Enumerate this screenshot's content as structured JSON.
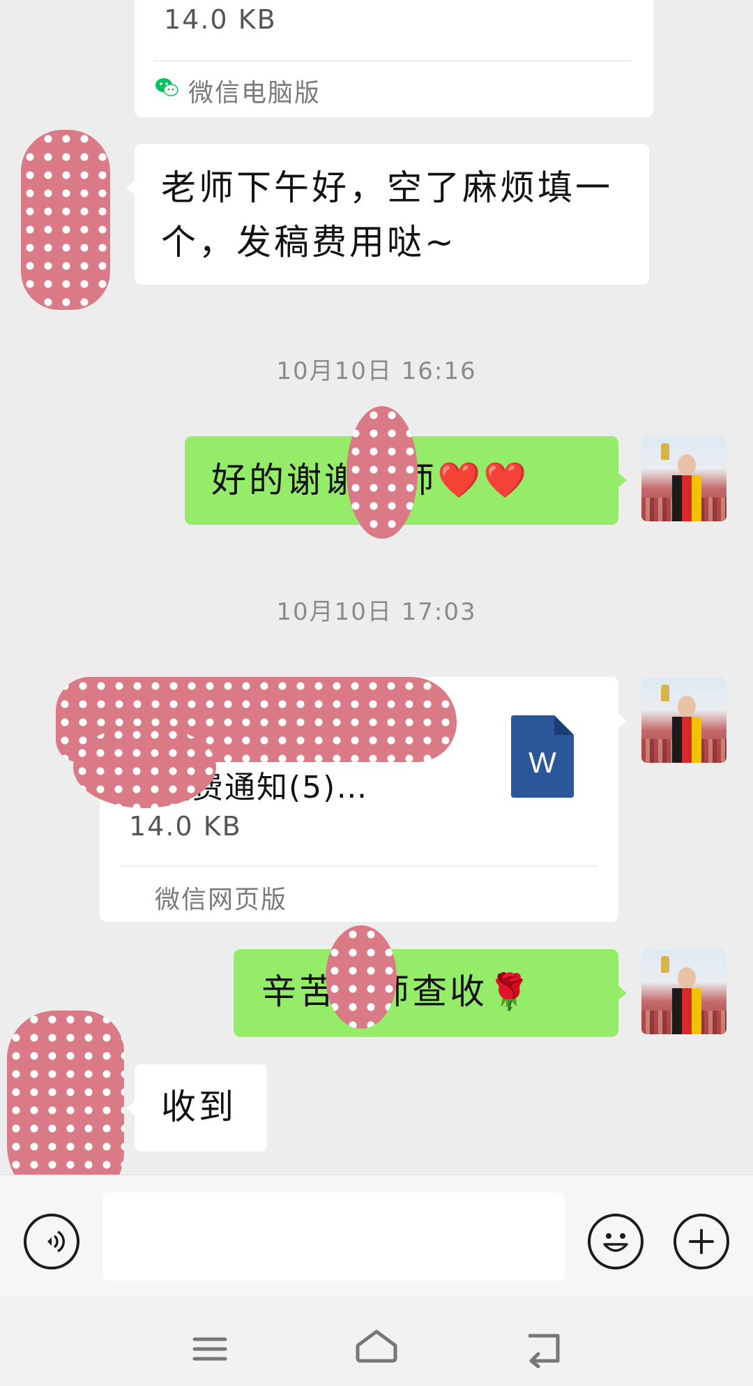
{
  "messages": {
    "top_file_size": "14.0 KB",
    "top_file_source": "微信电脑版",
    "incoming_1": "老师下午好，空了麻烦填一个，发稿费用哒~",
    "timestamp_1": "10月10日 16:16",
    "outgoing_1": "好的谢谢老师❤️❤️",
    "timestamp_2": "10月10日 17:03",
    "file_name": "稿费通知(5)…",
    "file_size": "14.0 KB",
    "file_source": "微信网页版",
    "file_icon_letter": "W",
    "outgoing_2": "辛苦老师查收🌹",
    "incoming_2": "收到"
  },
  "input_bar": {
    "voice_icon": "voice-icon",
    "emoji_icon": "emoji-icon",
    "plus_icon": "plus-icon",
    "message_field": ""
  },
  "nav_bar": {
    "menu_icon": "menu-icon",
    "home_icon": "home-icon",
    "back_icon": "back-icon"
  },
  "colors": {
    "background": "#ededed",
    "outgoing_bubble": "#95ec69",
    "incoming_bubble": "#ffffff",
    "word_icon": "#2b579a",
    "wechat_green": "#07c160",
    "redaction": "#d97a86"
  }
}
